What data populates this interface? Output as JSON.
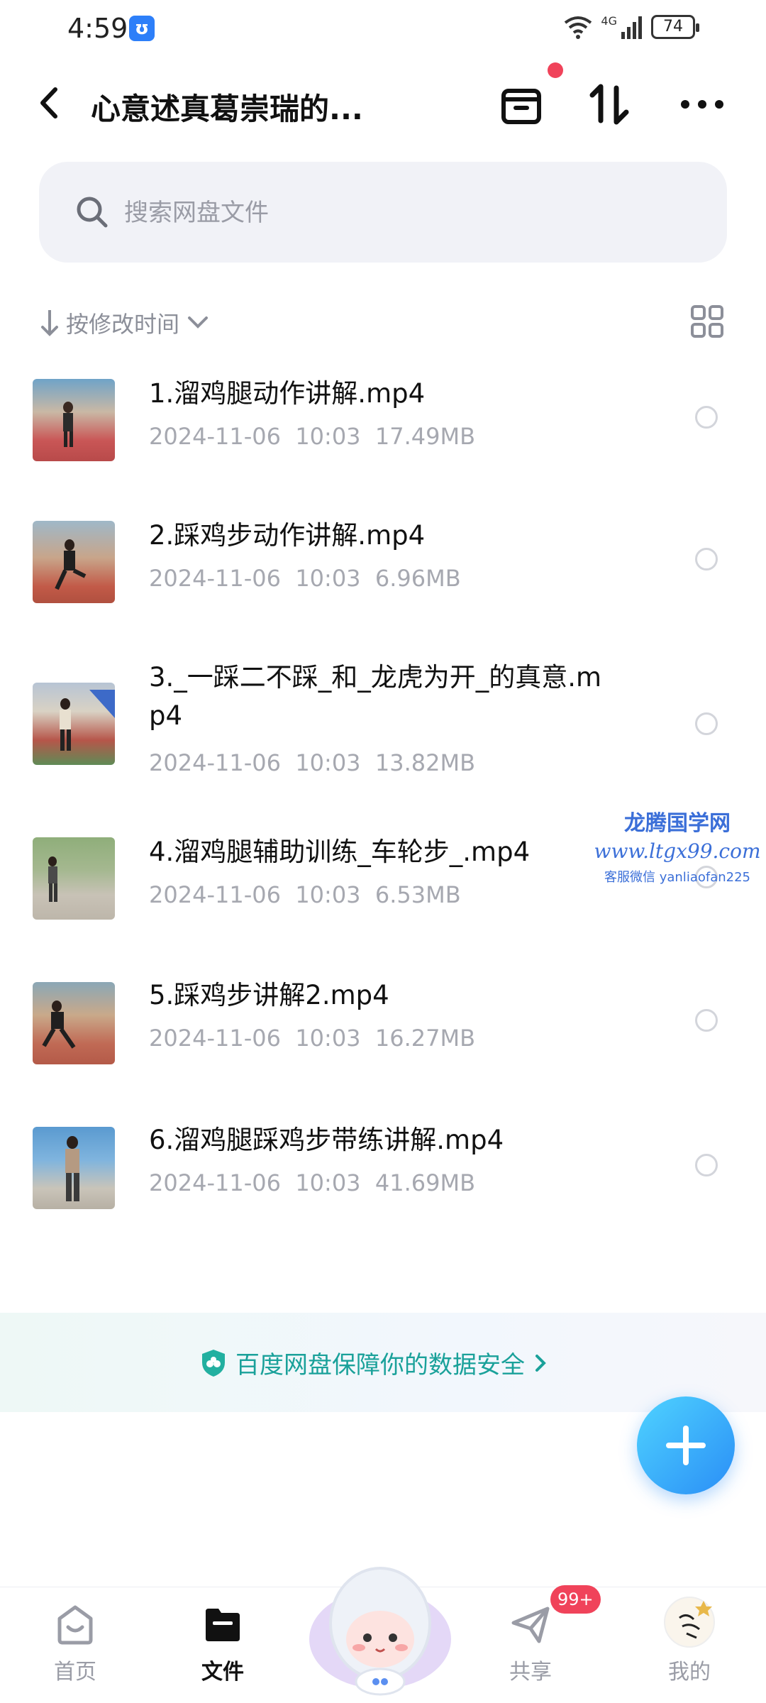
{
  "status_bar": {
    "time": "4:59",
    "app_icon_glyph": "ʊ",
    "network": "4G",
    "battery": "74"
  },
  "header": {
    "title": "心意述真葛崇瑞的..."
  },
  "search": {
    "placeholder": "搜索网盘文件"
  },
  "sort": {
    "label": "按修改时间"
  },
  "files": [
    {
      "name": "1.溜鸡腿动作讲解.mp4",
      "date": "2024-11-06",
      "time": "10:03",
      "size": "17.49MB"
    },
    {
      "name": "2.踩鸡步动作讲解.mp4",
      "date": "2024-11-06",
      "time": "10:03",
      "size": "6.96MB"
    },
    {
      "name": "3._一踩二不踩_和_龙虎为开_的真意.mp4",
      "date": "2024-11-06",
      "time": "10:03",
      "size": "13.82MB"
    },
    {
      "name": "4.溜鸡腿辅助训练_车轮步_.mp4",
      "date": "2024-11-06",
      "time": "10:03",
      "size": "6.53MB"
    },
    {
      "name": "5.踩鸡步讲解2.mp4",
      "date": "2024-11-06",
      "time": "10:03",
      "size": "16.27MB"
    },
    {
      "name": "6.溜鸡腿踩鸡步带练讲解.mp4",
      "date": "2024-11-06",
      "time": "10:03",
      "size": "41.69MB"
    }
  ],
  "watermark": {
    "line1": "龙腾国学网",
    "line2": "www.ltgx99.com",
    "line3": "客服微信 yanliaofan225"
  },
  "security_banner": {
    "text": "百度网盘保障你的数据安全"
  },
  "bottom_nav": {
    "home": "首页",
    "files": "文件",
    "share": "共享",
    "share_badge": "99+",
    "mine": "我的"
  },
  "colors": {
    "accent": "#2a8ef6",
    "badge": "#f0435a",
    "security": "#1aa19a"
  }
}
